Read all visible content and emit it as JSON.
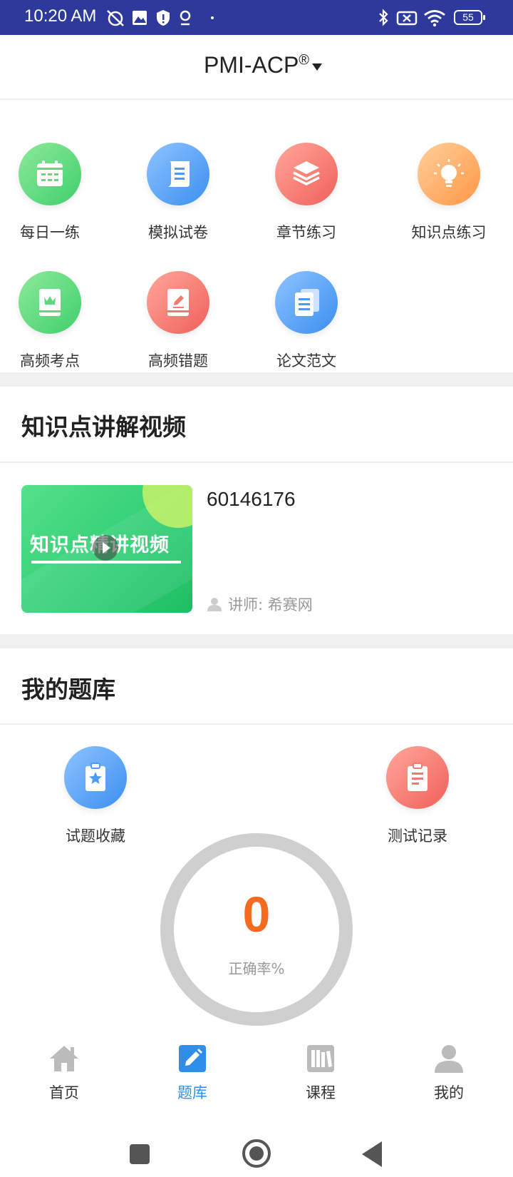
{
  "status_bar": {
    "time": "10:20 AM",
    "battery": "55"
  },
  "header": {
    "title": "PMI-ACP",
    "title_mark": "®"
  },
  "features": [
    {
      "label": "每日一练",
      "icon": "calendar-icon",
      "color": "green"
    },
    {
      "label": "模拟试卷",
      "icon": "scroll-icon",
      "color": "blue"
    },
    {
      "label": "章节练习",
      "icon": "layers-icon",
      "color": "red"
    },
    {
      "label": "知识点练习",
      "icon": "lightbulb-icon",
      "color": "orange"
    },
    {
      "label": "高频考点",
      "icon": "crown-book-icon",
      "color": "green"
    },
    {
      "label": "高频错题",
      "icon": "edit-book-icon",
      "color": "red"
    },
    {
      "label": "论文范文",
      "icon": "documents-icon",
      "color": "blue"
    }
  ],
  "video_section": {
    "title": "知识点讲解视频",
    "video": {
      "thumbnail_text": "知识点精讲视频",
      "title": "60146176",
      "teacher": "讲师: 希赛网"
    }
  },
  "bank_section": {
    "title": "我的题库",
    "favorites_label": "试题收藏",
    "records_label": "测试记录",
    "accuracy_value": "0",
    "accuracy_label": "正确率%"
  },
  "bottom_nav": [
    {
      "label": "首页",
      "icon": "home-icon",
      "active": false
    },
    {
      "label": "题库",
      "icon": "edit-square-icon",
      "active": true
    },
    {
      "label": "课程",
      "icon": "books-icon",
      "active": false
    },
    {
      "label": "我的",
      "icon": "person-icon",
      "active": false
    }
  ],
  "colors": {
    "status_bar": "#2d3a9c",
    "active_nav": "#2e8ee8",
    "accuracy": "#f46a1e"
  }
}
